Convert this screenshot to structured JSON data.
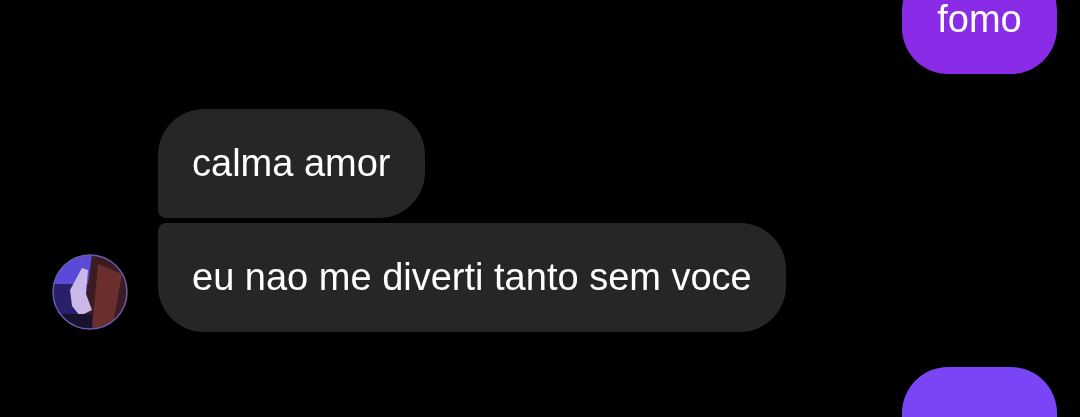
{
  "messages": [
    {
      "kind": "sent",
      "text": "fomo",
      "avatar": false
    },
    {
      "kind": "received",
      "text": "calma amor",
      "avatar": false
    },
    {
      "kind": "received",
      "text": "eu nao me diverti tanto sem voce",
      "avatar": true
    },
    {
      "kind": "sent",
      "avatar": false
    }
  ]
}
